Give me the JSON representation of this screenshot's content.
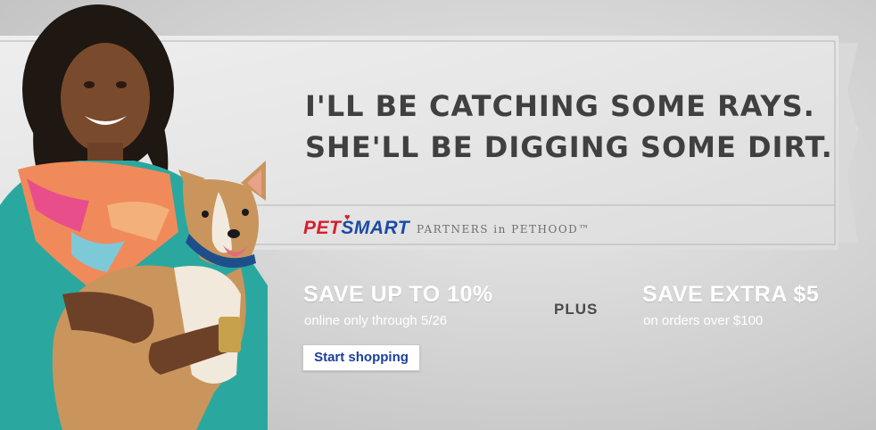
{
  "headline": {
    "line1": "I'LL BE CATCHING SOME RAYS.",
    "line2": "SHE'LL BE DIGGING SOME DIRT."
  },
  "brand": {
    "logo_pet": "PET",
    "logo_smart": "SMART",
    "tagline": "PARTNERS in PETHOOD™"
  },
  "offers": {
    "left_title": "SAVE UP TO 10%",
    "left_sub": "online only through 5/26",
    "plus": "PLUS",
    "right_title": "SAVE EXTRA $5",
    "right_sub": "on orders over $100"
  },
  "cta": {
    "label": "Start shopping"
  },
  "colors": {
    "brand_blue": "#1b4aa3",
    "brand_red": "#d61f2c",
    "headline": "#404040",
    "background": "#d4d4d4"
  },
  "icons": [
    "heart-icon"
  ]
}
